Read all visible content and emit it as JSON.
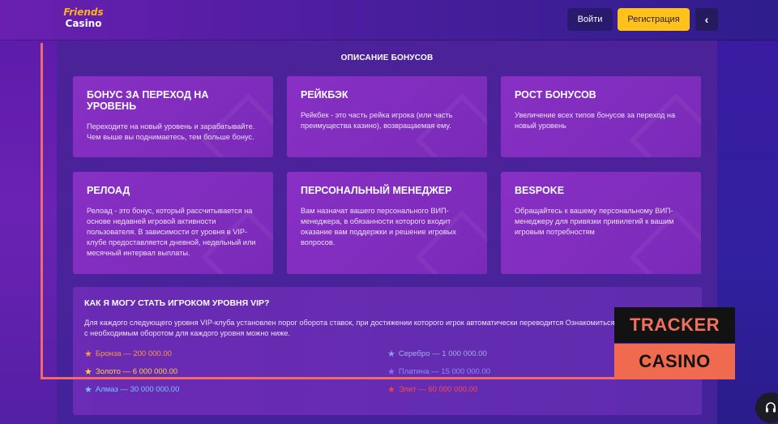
{
  "header": {
    "logo_line1": "Friends",
    "logo_line2": "Casino",
    "login_label": "Войти",
    "register_label": "Регистрация",
    "back_icon": "‹"
  },
  "section_title": "ОПИСАНИЕ БОНУСОВ",
  "cards": [
    {
      "title": "БОНУС ЗА ПЕРЕХОД НА УРОВЕНЬ",
      "text": "Переходите на новый уровень и зарабатывайте. Чем выше вы поднимаетесь, тем больше бонус."
    },
    {
      "title": "РЕЙКБЭК",
      "text": "Рейкбек - это часть рейка игрока (или часть преимущества казино), возвращаемая ему."
    },
    {
      "title": "РОСТ БОНУСОВ",
      "text": "Увеличение всех типов бонусов за переход на новый уровень"
    },
    {
      "title": "РЕЛОАД",
      "text": "Релоад - это бонус, который рассчитывается на основе недавней игровой активности пользователя. В зависимости от уровня в VIP-клубе предоставляется дневной, недельный или месячный интервал выплаты."
    },
    {
      "title": "ПЕРСОНАЛЬНЫЙ МЕНЕДЖЕР",
      "text": "Вам назначат вашего персонального ВИП-менеджера, в обязанности которого входит оказание вам поддержки и решение игровых вопросов."
    },
    {
      "title": "BESPOKE",
      "text": "Обращайтесь к вашему персональному ВИП-менеджеру для привязки привилегий к вашим игровым потребностям"
    }
  ],
  "vip": {
    "title": "КАК Я МОГУ СТАТЬ ИГРОКОМ УРОВНЯ VIP?",
    "text": "Для каждого следующего уровня VIP-клуба установлен порог оборота ставок, при достижении которого игрок автоматически переводится Ознакомиться с необходимым оборотом для каждого уровня можно ниже.",
    "tiers": [
      {
        "label": "Бронза — 200 000.00",
        "color": "#ff9a3c",
        "star_color": "#ff9a3c"
      },
      {
        "label": "Серебро — 1 000 000.00",
        "color": "#9fb0e8",
        "star_color": "#8ea0e6"
      },
      {
        "label": "Золото — 6 000 000.00",
        "color": "#ffd23a",
        "star_color": "#ffd23a"
      },
      {
        "label": "Платина — 15 000 000.00",
        "color": "#8a8cff",
        "star_color": "#8a6cff"
      },
      {
        "label": "Алмаз — 30 000 000.00",
        "color": "#6ec8ff",
        "star_color": "#6ec8ff"
      },
      {
        "label": "Элит — 60 000 000.00",
        "color": "#ff4a4a",
        "star_color": "#ff3a3a"
      }
    ]
  },
  "watermark": {
    "tracker": "TRACKER",
    "casino": "CASINO"
  },
  "support_icon": "headset-icon",
  "support_glyph": "🎧"
}
